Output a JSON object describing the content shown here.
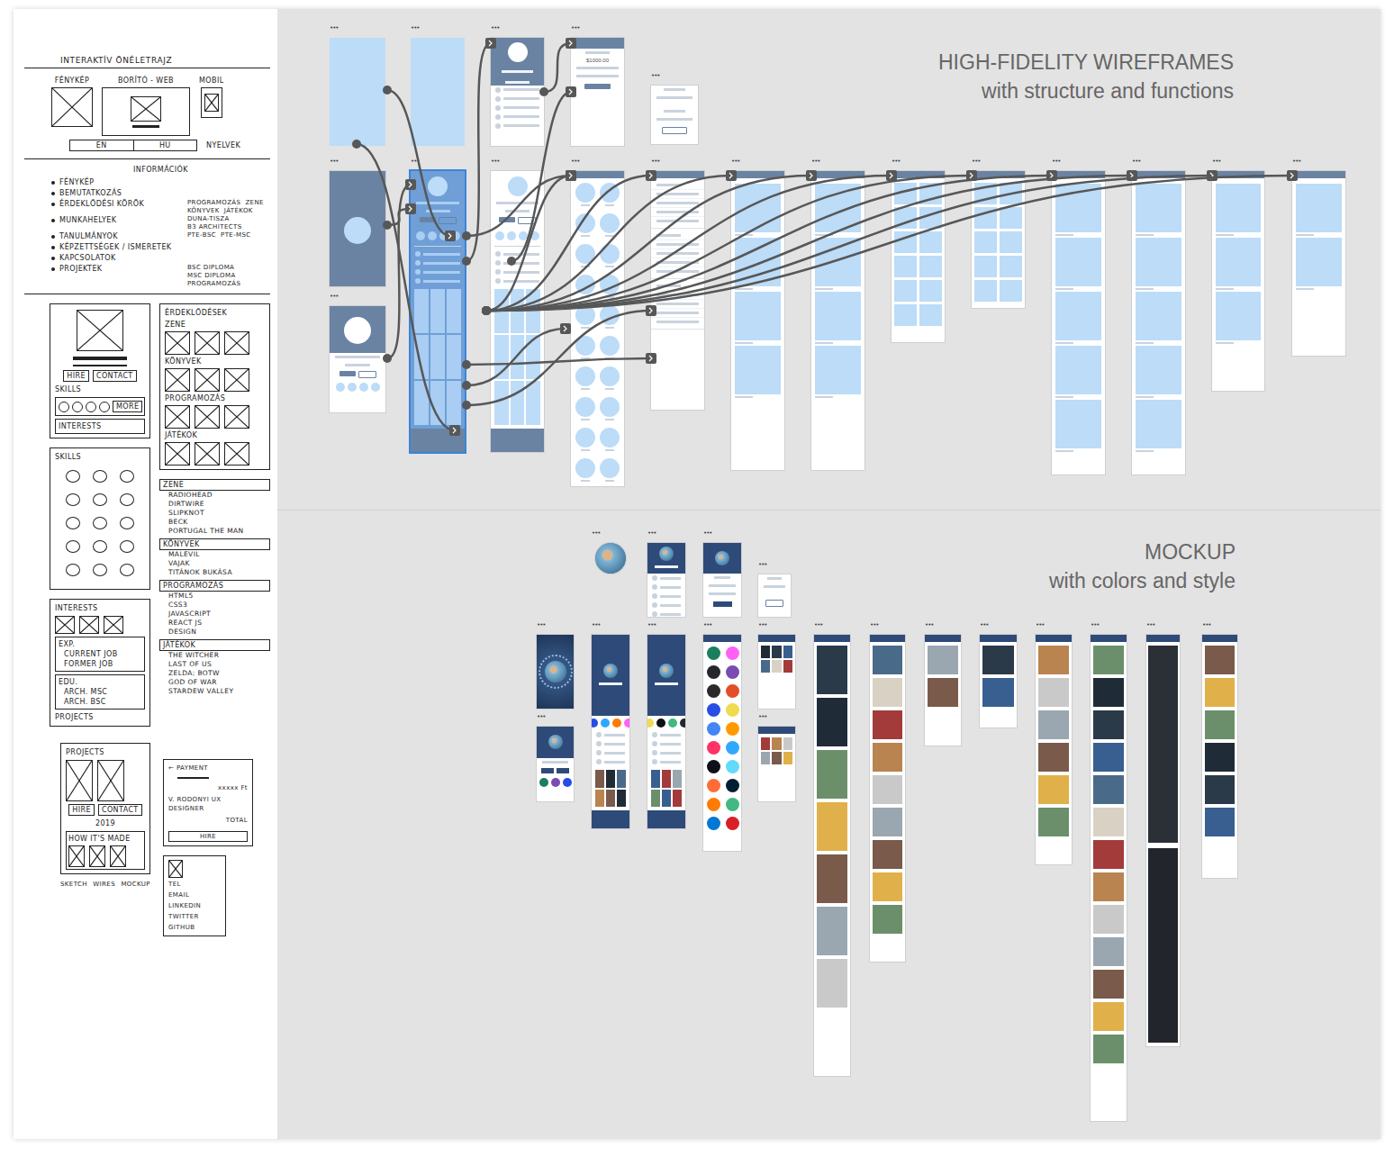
{
  "canvas": {
    "wireframes_title": "HIGH-FIDELITY WIREFRAMES",
    "wireframes_subtitle": "with structure and functions",
    "mockup_title": "MOCKUP",
    "mockup_subtitle": "with colors and style",
    "frame_menu": "•••"
  },
  "sketch": {
    "title": "INTERAKTÍV ÖNÉLETRAJZ",
    "cover": {
      "photo": "FÉNYKÉP",
      "web": "BORÍTÓ - WEB",
      "mobile": "MOBIL",
      "languages": [
        "EN",
        "HU"
      ],
      "languages_label": "NYELVEK"
    },
    "info": {
      "heading": "INFORMÁCIÓK",
      "items": [
        {
          "label": "FÉNYKÉP",
          "notes": []
        },
        {
          "label": "BEMUTATKOZÁS",
          "notes": []
        },
        {
          "label": "ÉRDEKLŐDÉSI KÖRÖK",
          "notes": [
            "PROGRAMOZÁS",
            "ZENE",
            "KÖNYVEK",
            "JÁTÉKOK"
          ]
        },
        {
          "label": "MUNKAHELYEK",
          "notes": [
            "DUNA-TISZA",
            "B3 ARCHITECTS"
          ]
        },
        {
          "label": "TANULMÁNYOK",
          "notes": [
            "PTE-BSC",
            "PTE-MSC"
          ]
        },
        {
          "label": "KÉPZETTSÉGEK / ISMERETEK",
          "notes": []
        },
        {
          "label": "KAPCSOLATOK",
          "notes": []
        },
        {
          "label": "PROJEKTEK",
          "notes": [
            "BSC DIPLOMA",
            "MSC DIPLOMA",
            "PROGRAMOZÁS"
          ]
        }
      ]
    },
    "home": {
      "buttons": [
        "HIRE",
        "CONTACT"
      ],
      "skills_label": "SKILLS",
      "more": "MORE",
      "interests_label": "INTERESTS"
    },
    "skills_page": {
      "label": "SKILLS"
    },
    "profile_page": {
      "interests_label": "INTERESTS",
      "experience_label": "EXP.",
      "jobs": [
        "CURRENT JOB",
        "FORMER JOB"
      ],
      "education_label": "EDU.",
      "degrees": [
        "ARCH. MSC",
        "ARCH. BSC"
      ],
      "projects_label": "PROJECTS"
    },
    "interests": {
      "heading": "ÉRDEKLŐDÉSEK",
      "categories": [
        "ZENE",
        "KÖNYVEK",
        "PROGRAMOZÁS",
        "JÁTÉKOK"
      ]
    },
    "lists": [
      {
        "heading": "ZENE",
        "items": [
          "RADIOHEAD",
          "DIRTWIRE",
          "SLIPKNOT",
          "BECK",
          "PORTUGAL THE MAN"
        ]
      },
      {
        "heading": "KÖNYVEK",
        "items": [
          "MALEVIL",
          "VAJAK",
          "TITÁNOK BUKÁSA"
        ]
      },
      {
        "heading": "PROGRAMOZÁS",
        "items": [
          "HTML5",
          "CSS3",
          "JAVASCRIPT",
          "REACT JS",
          "DESIGN"
        ]
      },
      {
        "heading": "JÁTÉKOK",
        "items": [
          "THE WITCHER",
          "LAST OF US",
          "ZELDA: BOTW",
          "GOD OF WAR",
          "STARDEW VALLEY"
        ]
      }
    ],
    "projects": {
      "heading": "PROJECTS",
      "buttons": [
        "HIRE",
        "CONTACT"
      ],
      "year": "2019",
      "how_label": "HOW IT'S MADE",
      "stages": [
        "SKETCH",
        "WIRES",
        "MOCKUP"
      ]
    },
    "payment": {
      "back": "←",
      "heading": "PAYMENT",
      "price": "xxxxx Ft",
      "item": "V. RODONYI UX DESIGNER",
      "total": "TOTAL",
      "button": "HIRE"
    },
    "contact": {
      "items": [
        "TEL",
        "EMAIL",
        "LINKEDIN",
        "TWITTER",
        "GITHUB"
      ]
    }
  },
  "wireframes": [
    {
      "kind": "blank",
      "selected": false
    },
    {
      "kind": "blank",
      "selected": false
    },
    {
      "kind": "card",
      "selected": false
    },
    {
      "kind": "payment",
      "selected": false,
      "amount": "$1000.00"
    },
    {
      "kind": "dialog",
      "selected": false
    },
    {
      "kind": "cover",
      "selected": false
    },
    {
      "kind": "profile",
      "selected": false
    },
    {
      "kind": "page",
      "selected": true
    },
    {
      "kind": "page",
      "selected": false
    },
    {
      "kind": "circles",
      "selected": false
    },
    {
      "kind": "list",
      "selected": false
    },
    {
      "kind": "blocks",
      "selected": false
    },
    {
      "kind": "blocks",
      "selected": false
    },
    {
      "kind": "grid",
      "selected": false
    },
    {
      "kind": "grid",
      "selected": false
    },
    {
      "kind": "blocks",
      "selected": false
    },
    {
      "kind": "blocks",
      "selected": false
    },
    {
      "kind": "blocks",
      "selected": false
    },
    {
      "kind": "blocks",
      "selected": false
    }
  ],
  "mockups": [
    {
      "kind": "photo"
    },
    {
      "kind": "card"
    },
    {
      "kind": "payment"
    },
    {
      "kind": "dialog"
    },
    {
      "kind": "cover"
    },
    {
      "kind": "profile"
    },
    {
      "kind": "page"
    },
    {
      "kind": "page"
    },
    {
      "kind": "icons"
    },
    {
      "kind": "gallery"
    },
    {
      "kind": "gallery"
    },
    {
      "kind": "books"
    },
    {
      "kind": "tiles"
    },
    {
      "kind": "tiles"
    },
    {
      "kind": "tiles"
    },
    {
      "kind": "tiles"
    },
    {
      "kind": "tiles"
    },
    {
      "kind": "code"
    },
    {
      "kind": "tiles"
    }
  ]
}
